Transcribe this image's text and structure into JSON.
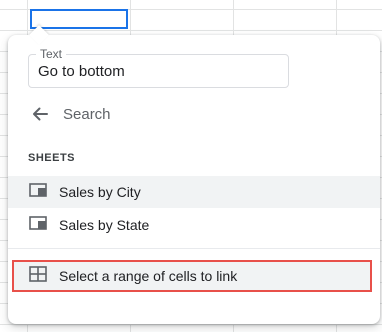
{
  "link_popup": {
    "text_field": {
      "label": "Text",
      "value": "Go to bottom"
    },
    "search": {
      "label": "Search",
      "icon": "arrow-back-icon"
    },
    "sheets_section": {
      "header": "SHEETS",
      "items": [
        {
          "label": "Sales by City",
          "icon": "sheet-tab-icon"
        },
        {
          "label": "Sales by State",
          "icon": "sheet-tab-icon"
        }
      ]
    },
    "range_option": {
      "label": "Select a range of cells to link",
      "icon": "grid-icon",
      "highlight_color": "#e8504a"
    }
  },
  "colors": {
    "active_cell_border": "#1a73e8",
    "hover_background": "#f1f3f4"
  }
}
